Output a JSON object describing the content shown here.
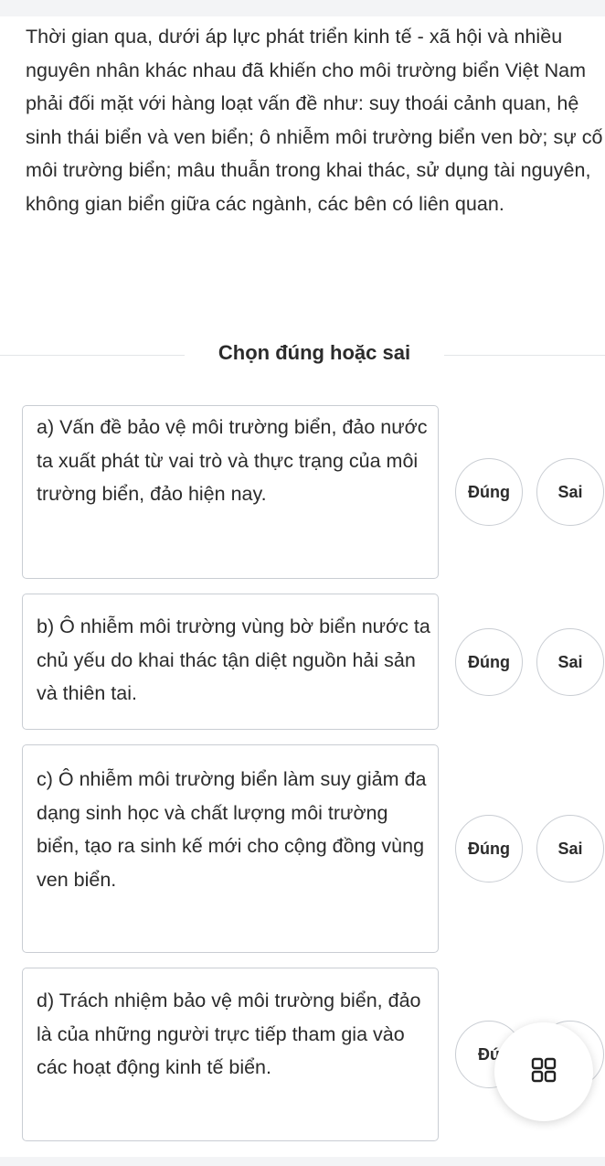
{
  "passage": {
    "text": "Thời gian qua, dưới áp lực phát triển kinh tế - xã hội và nhiều nguyên nhân khác nhau đã khiến cho môi trường biển Việt Nam phải đối mặt với hàng loạt vấn đề như: suy thoái cảnh quan, hệ sinh thái biển và ven biển; ô nhiễm môi trường biển ven bờ; sự cố môi trường biển; mâu thuẫn trong khai thác, sử dụng tài nguyên, không gian biển giữa các ngành, các bên có liên quan."
  },
  "section": {
    "title": "Chọn đúng hoặc sai"
  },
  "statements": [
    {
      "text": "a) Vấn đề bảo vệ môi trường biển, đảo nước ta xuất phát từ vai trò và thực trạng của môi trường biển, đảo hiện nay.",
      "true_label": "Đúng",
      "false_label": "Sai"
    },
    {
      "text": "b) Ô nhiễm môi trường vùng bờ biển nước ta chủ yếu do khai thác tận diệt nguồn hải sản và thiên tai.",
      "true_label": "Đúng",
      "false_label": "Sai"
    },
    {
      "text": "c) Ô nhiễm môi trường biển làm suy giảm đa dạng sinh học và chất lượng môi trường biển, tạo ra sinh kế mới cho cộng đồng vùng ven biển.",
      "true_label": "Đúng",
      "false_label": "Sai"
    },
    {
      "text": "d) Trách nhiệm bảo vệ môi trường biển, đảo là của những người trực tiếp tham gia vào các hoạt động kinh tế biển.",
      "true_label": "Đú",
      "false_label": ""
    }
  ],
  "fab": {
    "icon": "grid-icon"
  }
}
